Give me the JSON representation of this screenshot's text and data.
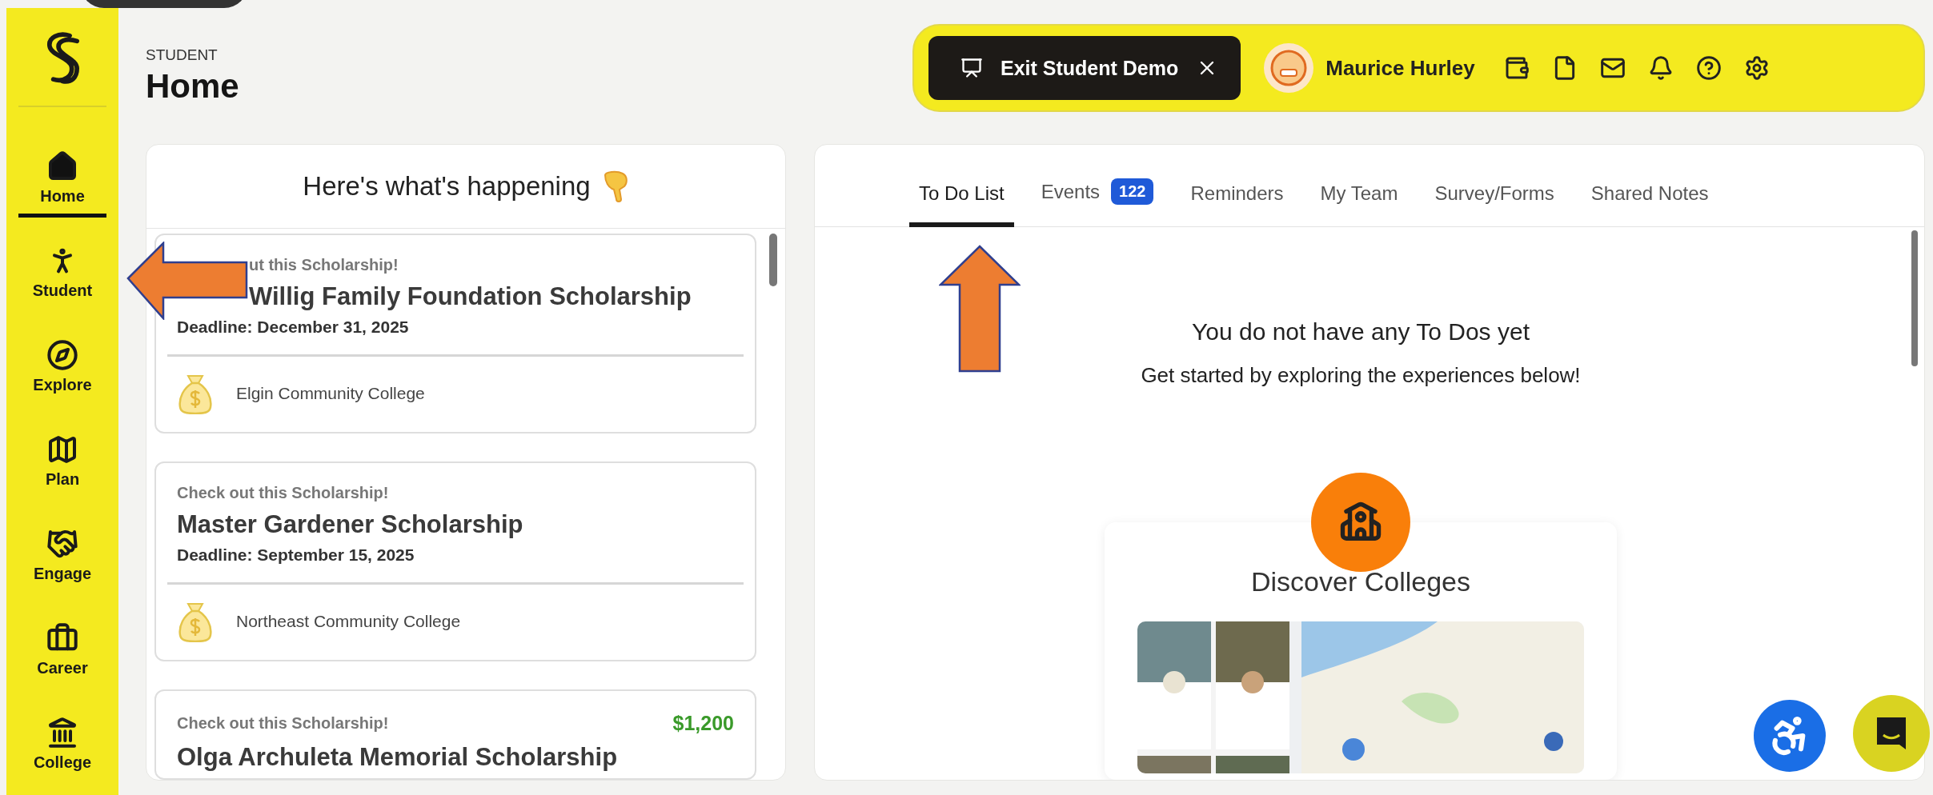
{
  "nav": {
    "items": [
      {
        "label": "Home",
        "selected": true
      },
      {
        "label": "Student",
        "selected": false
      },
      {
        "label": "Explore",
        "selected": false
      },
      {
        "label": "Plan",
        "selected": false
      },
      {
        "label": "Engage",
        "selected": false
      },
      {
        "label": "Career",
        "selected": false
      },
      {
        "label": "College",
        "selected": false
      }
    ]
  },
  "header": {
    "section": "STUDENT",
    "title": "Home"
  },
  "top_bar": {
    "exit_button": "Exit Student Demo",
    "user_name": "Maurice Hurley"
  },
  "feed": {
    "title": "Here's what's happening",
    "cards": [
      {
        "label": "ut this Scholarship!",
        "title": "Willig Family Foundation Scholarship",
        "deadline": "Deadline: December 31, 2025",
        "college": "Elgin Community College"
      },
      {
        "label": "Check out this Scholarship!",
        "title": "Master Gardener Scholarship",
        "deadline": "Deadline: September 15, 2025",
        "college": "Northeast Community College"
      },
      {
        "label": "Check out this Scholarship!",
        "title": "Olga Archuleta Memorial Scholarship",
        "amount": "$1,200"
      }
    ]
  },
  "tabs": [
    {
      "label": "To Do List",
      "selected": true
    },
    {
      "label": "Events",
      "selected": false,
      "badge": "122"
    },
    {
      "label": "Reminders",
      "selected": false
    },
    {
      "label": "My Team",
      "selected": false
    },
    {
      "label": "Survey/Forms",
      "selected": false
    },
    {
      "label": "Shared Notes",
      "selected": false
    }
  ],
  "empty_state": {
    "title": "You do not have any To Dos yet",
    "subtitle": "Get started by exploring the experiences below!"
  },
  "experience_card": {
    "title": "Discover Colleges"
  }
}
